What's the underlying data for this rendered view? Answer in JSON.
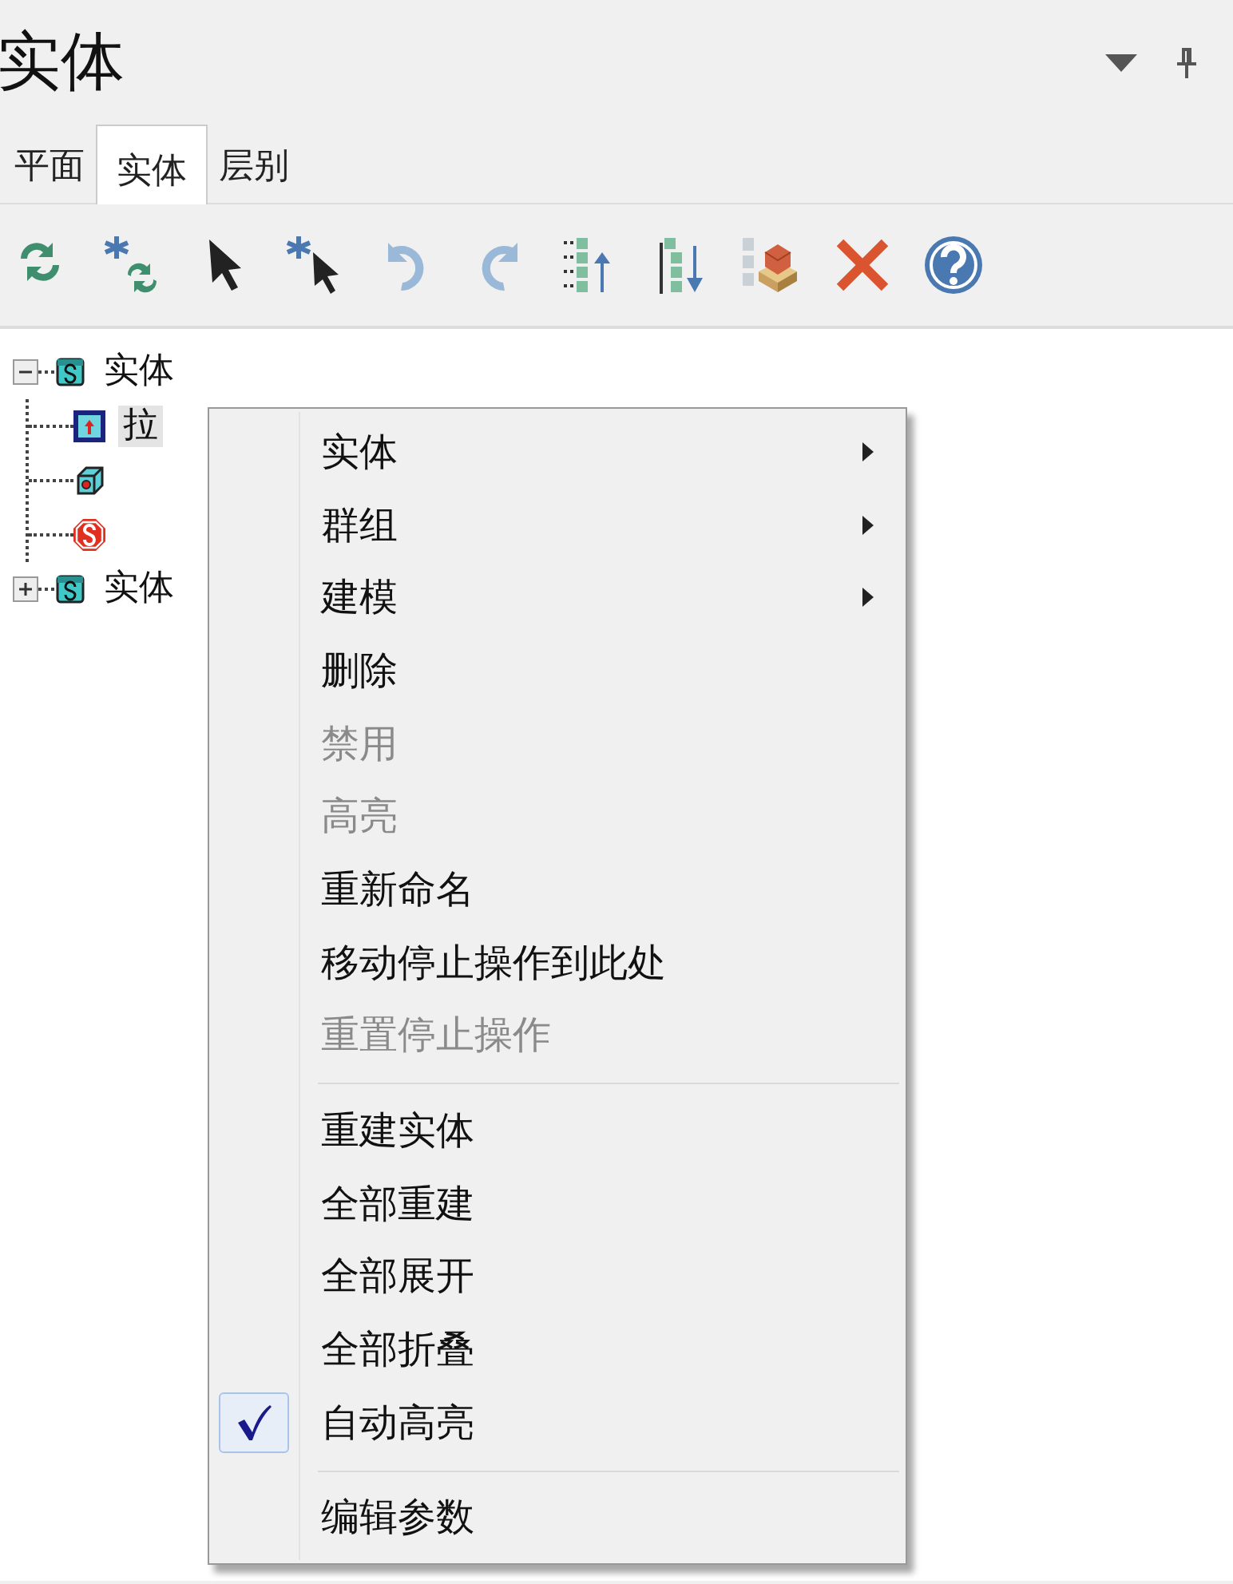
{
  "panel": {
    "title": "实体"
  },
  "tabs": [
    {
      "label": "平面",
      "selected": false
    },
    {
      "label": "实体",
      "selected": true
    },
    {
      "label": "层别",
      "selected": false
    }
  ],
  "tree": [
    {
      "kind": "solid",
      "label": "实体",
      "expanded": true,
      "selected": false,
      "children": [
        {
          "kind": "extrude",
          "label": "拉",
          "selected": true
        },
        {
          "kind": "hole",
          "selected": false
        },
        {
          "kind": "stop",
          "selected": false
        }
      ]
    },
    {
      "kind": "solid",
      "label": "实体",
      "expanded": false,
      "selected": false
    }
  ],
  "context_menu": [
    {
      "kind": "item",
      "label": "实体",
      "submenu": true,
      "disabled": false,
      "checked": false
    },
    {
      "kind": "item",
      "label": "群组",
      "submenu": true,
      "disabled": false,
      "checked": false
    },
    {
      "kind": "item",
      "label": "建模",
      "submenu": true,
      "disabled": false,
      "checked": false
    },
    {
      "kind": "item",
      "label": "删除",
      "submenu": false,
      "disabled": false,
      "checked": false
    },
    {
      "kind": "item",
      "label": "禁用",
      "submenu": false,
      "disabled": true,
      "checked": false
    },
    {
      "kind": "item",
      "label": "高亮",
      "submenu": false,
      "disabled": true,
      "checked": false
    },
    {
      "kind": "item",
      "label": "重新命名",
      "submenu": false,
      "disabled": false,
      "checked": false
    },
    {
      "kind": "item",
      "label": "移动停止操作到此处",
      "submenu": false,
      "disabled": false,
      "checked": false
    },
    {
      "kind": "item",
      "label": "重置停止操作",
      "submenu": false,
      "disabled": true,
      "checked": false
    },
    {
      "kind": "separator"
    },
    {
      "kind": "item",
      "label": "重建实体",
      "submenu": false,
      "disabled": false,
      "checked": false
    },
    {
      "kind": "item",
      "label": "全部重建",
      "submenu": false,
      "disabled": false,
      "checked": false
    },
    {
      "kind": "item",
      "label": "全部展开",
      "submenu": false,
      "disabled": false,
      "checked": false
    },
    {
      "kind": "item",
      "label": "全部折叠",
      "submenu": false,
      "disabled": false,
      "checked": false
    },
    {
      "kind": "item",
      "label": "自动高亮",
      "submenu": false,
      "disabled": false,
      "checked": true
    },
    {
      "kind": "separator"
    },
    {
      "kind": "item",
      "label": "编辑参数",
      "submenu": false,
      "disabled": false,
      "checked": false
    }
  ]
}
